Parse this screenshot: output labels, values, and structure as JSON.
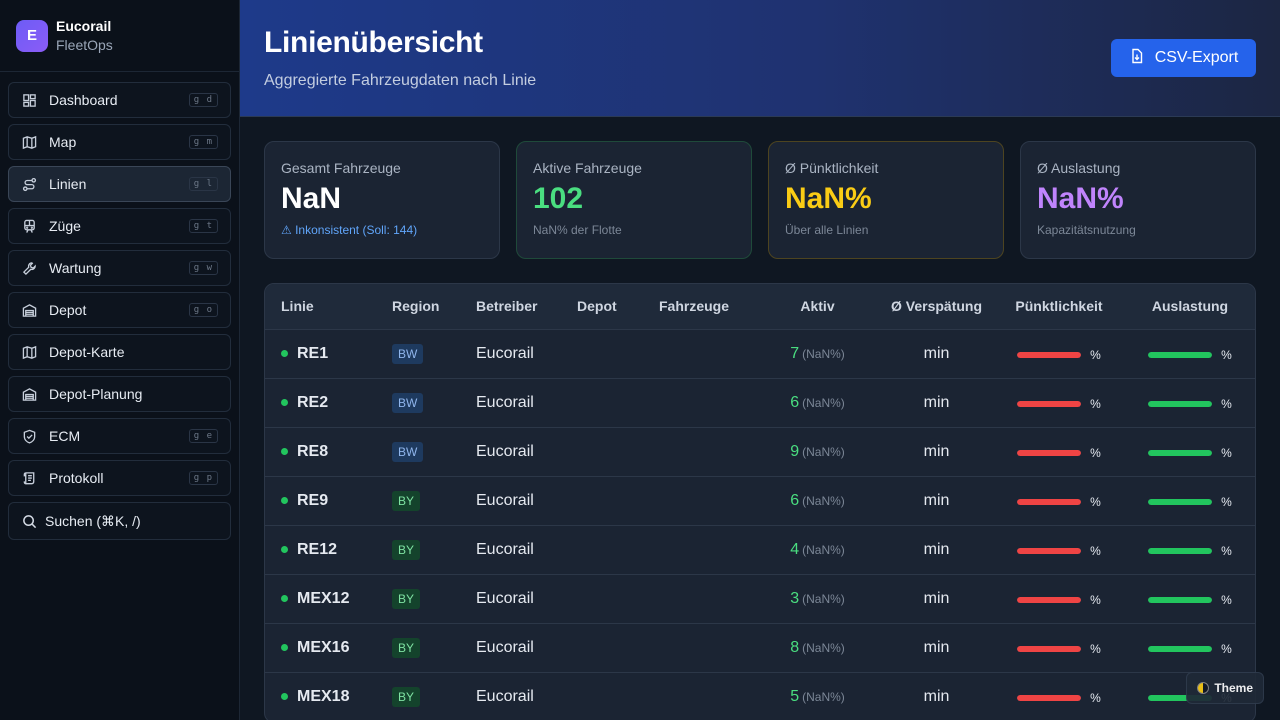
{
  "brand": {
    "logo_letter": "E",
    "name": "Eucorail",
    "sub": "FleetOps"
  },
  "sidebar": {
    "items": [
      {
        "label": "Dashboard",
        "shortcut": "g d",
        "icon": "dashboard-icon",
        "active": false
      },
      {
        "label": "Map",
        "shortcut": "g m",
        "icon": "map-icon",
        "active": false
      },
      {
        "label": "Linien",
        "shortcut": "g l",
        "icon": "route-icon",
        "active": true
      },
      {
        "label": "Züge",
        "shortcut": "g t",
        "icon": "train-icon",
        "active": false
      },
      {
        "label": "Wartung",
        "shortcut": "g w",
        "icon": "wrench-icon",
        "active": false
      },
      {
        "label": "Depot",
        "shortcut": "g o",
        "icon": "warehouse-icon",
        "active": false
      },
      {
        "label": "Depot-Karte",
        "shortcut": "",
        "icon": "map-icon",
        "active": false
      },
      {
        "label": "Depot-Planung",
        "shortcut": "",
        "icon": "warehouse-icon",
        "active": false
      },
      {
        "label": "ECM",
        "shortcut": "g e",
        "icon": "shield-check-icon",
        "active": false
      },
      {
        "label": "Protokoll",
        "shortcut": "g p",
        "icon": "scroll-icon",
        "active": false
      }
    ],
    "search_label": "Suchen (⌘K, /)"
  },
  "header": {
    "title": "Linienübersicht",
    "subtitle": "Aggregierte Fahrzeugdaten nach Linie",
    "export_label": "CSV-Export"
  },
  "cards": [
    {
      "label": "Gesamt Fahrzeuge",
      "value": "NaN",
      "note": "⚠ Inkonsistent (Soll: 144)"
    },
    {
      "label": "Aktive Fahrzeuge",
      "value": "102",
      "note": "NaN% der Flotte"
    },
    {
      "label": "Ø Pünktlichkeit",
      "value": "NaN%",
      "note": "Über alle Linien"
    },
    {
      "label": "Ø Auslastung",
      "value": "NaN%",
      "note": "Kapazitätsnutzung"
    }
  ],
  "table": {
    "headers": [
      "Linie",
      "Region",
      "Betreiber",
      "Depot",
      "Fahrzeuge",
      "Aktiv",
      "Ø Verspätung",
      "Pünktlichkeit",
      "Auslastung"
    ],
    "rows": [
      {
        "linie": "RE1",
        "region": "BW",
        "betreiber": "Eucorail",
        "depot": "",
        "fahrzeuge": "",
        "aktiv": "7",
        "aktiv_pct": "(NaN%)",
        "versp": "min",
        "puenkt": "%",
        "ausl": "%"
      },
      {
        "linie": "RE2",
        "region": "BW",
        "betreiber": "Eucorail",
        "depot": "",
        "fahrzeuge": "",
        "aktiv": "6",
        "aktiv_pct": "(NaN%)",
        "versp": "min",
        "puenkt": "%",
        "ausl": "%"
      },
      {
        "linie": "RE8",
        "region": "BW",
        "betreiber": "Eucorail",
        "depot": "",
        "fahrzeuge": "",
        "aktiv": "9",
        "aktiv_pct": "(NaN%)",
        "versp": "min",
        "puenkt": "%",
        "ausl": "%"
      },
      {
        "linie": "RE9",
        "region": "BY",
        "betreiber": "Eucorail",
        "depot": "",
        "fahrzeuge": "",
        "aktiv": "6",
        "aktiv_pct": "(NaN%)",
        "versp": "min",
        "puenkt": "%",
        "ausl": "%"
      },
      {
        "linie": "RE12",
        "region": "BY",
        "betreiber": "Eucorail",
        "depot": "",
        "fahrzeuge": "",
        "aktiv": "4",
        "aktiv_pct": "(NaN%)",
        "versp": "min",
        "puenkt": "%",
        "ausl": "%"
      },
      {
        "linie": "MEX12",
        "region": "BY",
        "betreiber": "Eucorail",
        "depot": "",
        "fahrzeuge": "",
        "aktiv": "3",
        "aktiv_pct": "(NaN%)",
        "versp": "min",
        "puenkt": "%",
        "ausl": "%"
      },
      {
        "linie": "MEX16",
        "region": "BY",
        "betreiber": "Eucorail",
        "depot": "",
        "fahrzeuge": "",
        "aktiv": "8",
        "aktiv_pct": "(NaN%)",
        "versp": "min",
        "puenkt": "%",
        "ausl": "%"
      },
      {
        "linie": "MEX18",
        "region": "BY",
        "betreiber": "Eucorail",
        "depot": "",
        "fahrzeuge": "",
        "aktiv": "5",
        "aktiv_pct": "(NaN%)",
        "versp": "min",
        "puenkt": "%",
        "ausl": "%"
      }
    ]
  },
  "theme_label": "Theme",
  "colors": {
    "accent": "#2563eb",
    "active_green": "#4ade80",
    "punctuality_yellow": "#facc15",
    "utilization_purple": "#c084fc",
    "bar_red": "#ef4444",
    "bar_green": "#22c55e"
  }
}
